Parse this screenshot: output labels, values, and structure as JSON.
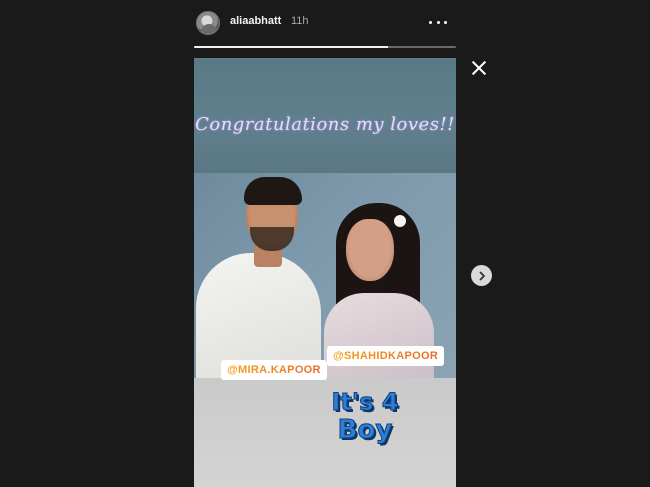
{
  "story": {
    "username": "aliaabhatt",
    "time": "11h",
    "progress_fraction": 0.74,
    "caption": "Congratulations my loves!!",
    "mentions": [
      "@MIRA.KAPOOR",
      "@SHAHIDKAPOOR"
    ],
    "sticker_lines": [
      "It's 4",
      "Boy"
    ]
  },
  "icons": {
    "more": "more-horizontal-icon",
    "close": "close-icon",
    "next": "chevron-right-icon"
  },
  "colors": {
    "background": "#1a1a1a",
    "caption": "#e8d8ff",
    "mention_gradient": [
      "#f6a01a",
      "#e8682b"
    ],
    "sticker": "#2e7fd6"
  }
}
